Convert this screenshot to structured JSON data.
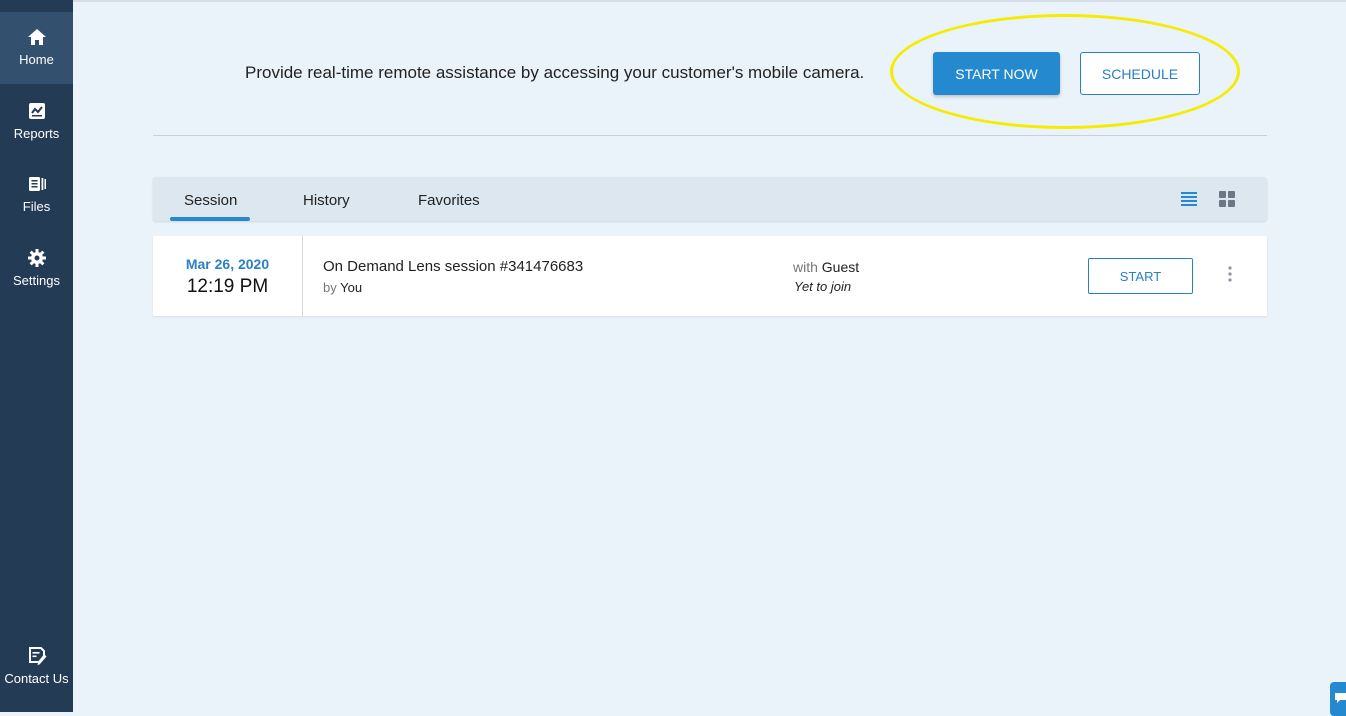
{
  "sidebar": {
    "items": [
      {
        "label": "Home",
        "icon": "home-icon",
        "active": true
      },
      {
        "label": "Reports",
        "icon": "reports-icon",
        "active": false
      },
      {
        "label": "Files",
        "icon": "files-icon",
        "active": false
      },
      {
        "label": "Settings",
        "icon": "gear-icon",
        "active": false
      }
    ],
    "contact": {
      "label": "Contact Us",
      "icon": "contact-icon"
    }
  },
  "banner": {
    "text": "Provide real-time remote assistance by accessing your customer's mobile camera.",
    "start_now_label": "START NOW",
    "schedule_label": "SCHEDULE"
  },
  "tabs": [
    {
      "label": "Session",
      "active": true
    },
    {
      "label": "History",
      "active": false
    },
    {
      "label": "Favorites",
      "active": false
    }
  ],
  "view_toggle": {
    "list_icon": "list-view-icon",
    "grid_icon": "grid-view-icon",
    "selected": "list"
  },
  "sessions": [
    {
      "date": "Mar 26, 2020",
      "time": "12:19 PM",
      "title": "On Demand Lens session #341476683",
      "by_prefix": "by",
      "by": "You",
      "with_prefix": "with",
      "with": "Guest",
      "status": "Yet to join",
      "start_label": "START"
    }
  ],
  "colors": {
    "sidebar_bg": "#243b55",
    "accent": "#2589d0",
    "highlight": "#f5ec00",
    "page_bg": "#ebf3fa"
  }
}
